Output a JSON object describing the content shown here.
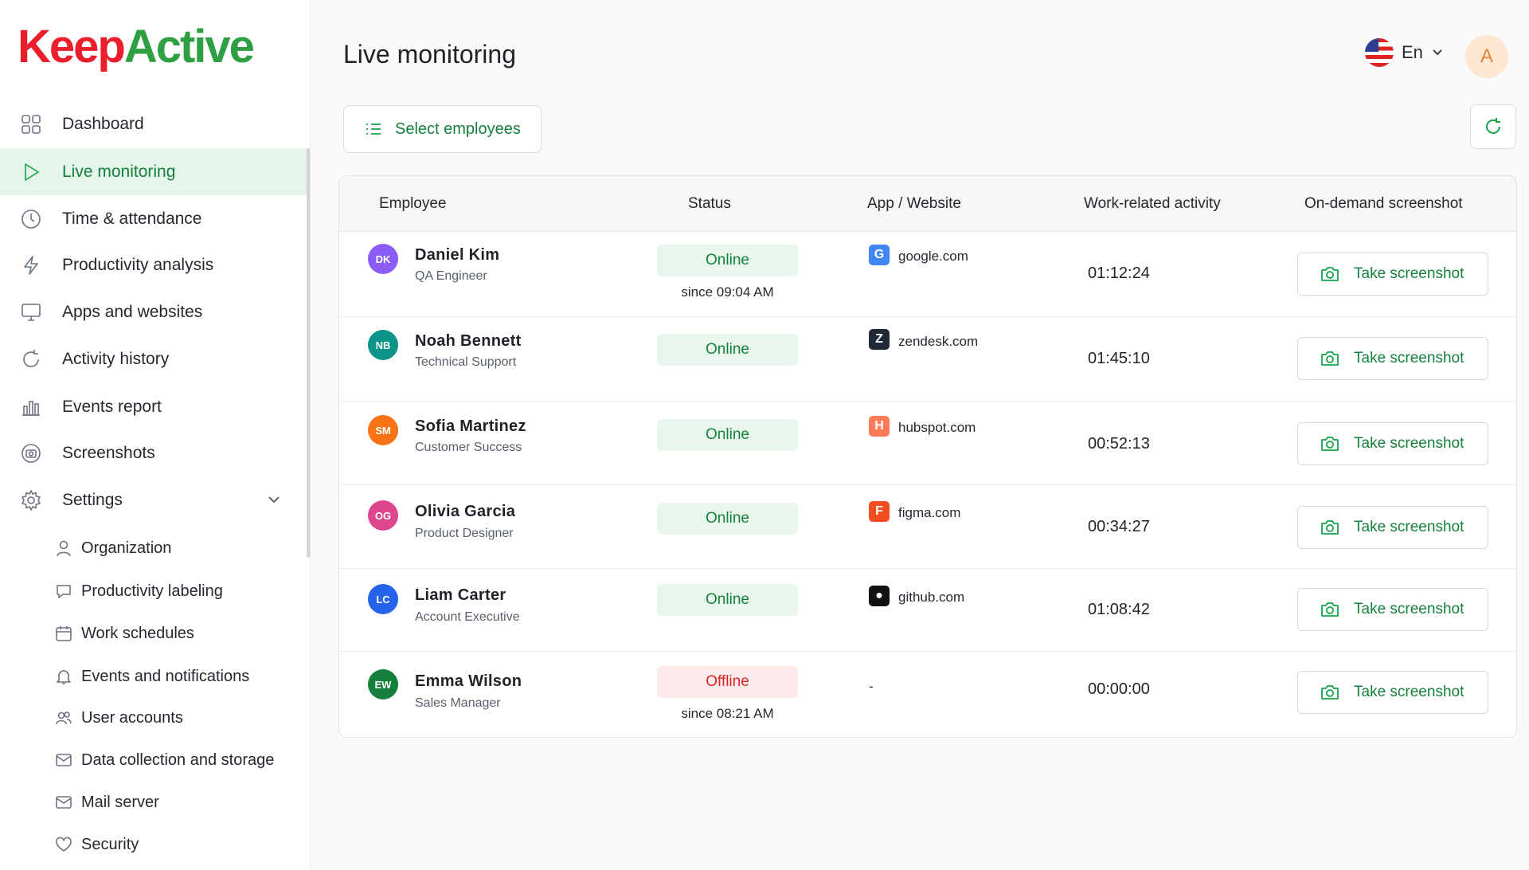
{
  "brand": {
    "part1": "Keep",
    "part2": "Active"
  },
  "sidebar": {
    "items": [
      {
        "label": "Dashboard",
        "icon": "grid-icon"
      },
      {
        "label": "Live monitoring",
        "icon": "play-icon",
        "active": true
      },
      {
        "label": "Time & attendance",
        "icon": "clock-icon"
      },
      {
        "label": "Productivity analysis",
        "icon": "bolt-icon"
      },
      {
        "label": "Apps and websites",
        "icon": "monitor-icon"
      },
      {
        "label": "Activity history",
        "icon": "history-icon"
      },
      {
        "label": "Events report",
        "icon": "chart-icon"
      },
      {
        "label": "Screenshots",
        "icon": "screenshot-icon"
      },
      {
        "label": "Settings",
        "icon": "gear-icon",
        "expanded": true
      }
    ],
    "settings_items": [
      {
        "label": "Organization",
        "icon": "user-icon"
      },
      {
        "label": "Productivity labeling",
        "icon": "speech-bubble-icon"
      },
      {
        "label": "Work schedules",
        "icon": "calendar-icon"
      },
      {
        "label": "Events and notifications",
        "icon": "bell-icon"
      },
      {
        "label": "User accounts",
        "icon": "users-icon"
      },
      {
        "label": "Data collection and storage",
        "icon": "envelope-icon"
      },
      {
        "label": "Mail server",
        "icon": "mail-icon"
      },
      {
        "label": "Security",
        "icon": "heart-icon"
      }
    ]
  },
  "header": {
    "title": "Live monitoring",
    "language": "En",
    "avatar_initial": "A"
  },
  "toolbar": {
    "select_label": "Select employees"
  },
  "table": {
    "columns": [
      "Employee",
      "Status",
      "App / Website",
      "Work-related activity",
      "On-demand screenshot"
    ],
    "rows": [
      {
        "initials": "DK",
        "avatar_color": "#8b5cf6",
        "name": "Daniel Kim",
        "role": "QA Engineer",
        "status": "Online",
        "status_type": "online",
        "since": "since 09:04 AM",
        "app": "google.com",
        "app_icon": "google-icon",
        "app_color": "#4285f4",
        "app_glyph": "G",
        "activity": "01:12:24",
        "action": "Take screenshot"
      },
      {
        "initials": "NB",
        "avatar_color": "#0d9488",
        "name": "Noah Bennett",
        "role": "Technical Support",
        "status": "Online",
        "status_type": "online",
        "since": "",
        "app": "zendesk.com",
        "app_icon": "zendesk-icon",
        "app_color": "#1f2937",
        "app_glyph": "Z",
        "activity": "01:45:10",
        "action": "Take screenshot"
      },
      {
        "initials": "SM",
        "avatar_color": "#f97316",
        "name": "Sofia Martinez",
        "role": "Customer Success",
        "status": "Online",
        "status_type": "online",
        "since": "",
        "app": "hubspot.com",
        "app_icon": "hubspot-icon",
        "app_color": "#ff7a59",
        "app_glyph": "H",
        "activity": "00:52:13",
        "action": "Take screenshot"
      },
      {
        "initials": "OG",
        "avatar_color": "#e0468f",
        "name": "Olivia Garcia",
        "role": "Product Designer",
        "status": "Online",
        "status_type": "online",
        "since": "",
        "app": "figma.com",
        "app_icon": "figma-icon",
        "app_color": "#f24e1e",
        "app_glyph": "F",
        "activity": "00:34:27",
        "action": "Take screenshot"
      },
      {
        "initials": "LC",
        "avatar_color": "#2563eb",
        "name": "Liam Carter",
        "role": "Account Executive",
        "status": "Online",
        "status_type": "online",
        "since": "",
        "app": "github.com",
        "app_icon": "github-icon",
        "app_color": "#111111",
        "app_glyph": "●",
        "activity": "01:08:42",
        "action": "Take screenshot"
      },
      {
        "initials": "EW",
        "avatar_color": "#15803d",
        "name": "Emma Wilson",
        "role": "Sales Manager",
        "status": "Offline",
        "status_type": "offline",
        "since": "since 08:21 AM",
        "app": "-",
        "app_icon": "",
        "app_color": "",
        "app_glyph": "",
        "activity": "00:00:00",
        "action": "Take screenshot"
      }
    ]
  }
}
